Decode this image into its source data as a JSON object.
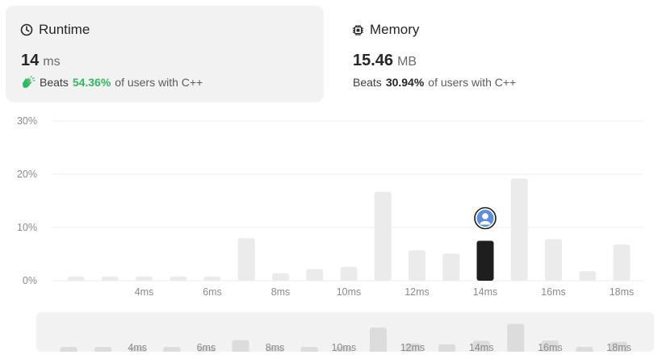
{
  "runtime": {
    "title": "Runtime",
    "value": "14",
    "unit": "ms",
    "beats_label": "Beats",
    "beats_pct": "54.36%",
    "suffix": "of users with C++",
    "icon": "clock-icon",
    "accent": "#2cbb5d"
  },
  "memory": {
    "title": "Memory",
    "value": "15.46",
    "unit": "MB",
    "beats_label": "Beats",
    "beats_pct": "30.94%",
    "suffix": "of users with C++",
    "icon": "chip-icon"
  },
  "chart_data": {
    "type": "bar",
    "y_ticks": [
      "0%",
      "10%",
      "20%",
      "30%"
    ],
    "ylim": [
      0,
      30
    ],
    "x_tick_labels": [
      "4ms",
      "6ms",
      "8ms",
      "10ms",
      "12ms",
      "14ms",
      "16ms",
      "18ms"
    ],
    "values": [
      0.8,
      0.8,
      0.8,
      0.8,
      0.8,
      8.0,
      1.4,
      2.2,
      2.6,
      16.7,
      5.7,
      5.1,
      7.5,
      19.2,
      7.8,
      1.8,
      6.8
    ],
    "highlight_index": 12,
    "highlight_color": "#1e1e1e",
    "bar_color": "#ebebeb",
    "avatar_color": "#5d8fe0"
  },
  "brush": {
    "x_tick_labels": [
      "4ms",
      "6ms",
      "8ms",
      "10ms",
      "12ms",
      "14ms",
      "16ms",
      "18ms"
    ]
  }
}
